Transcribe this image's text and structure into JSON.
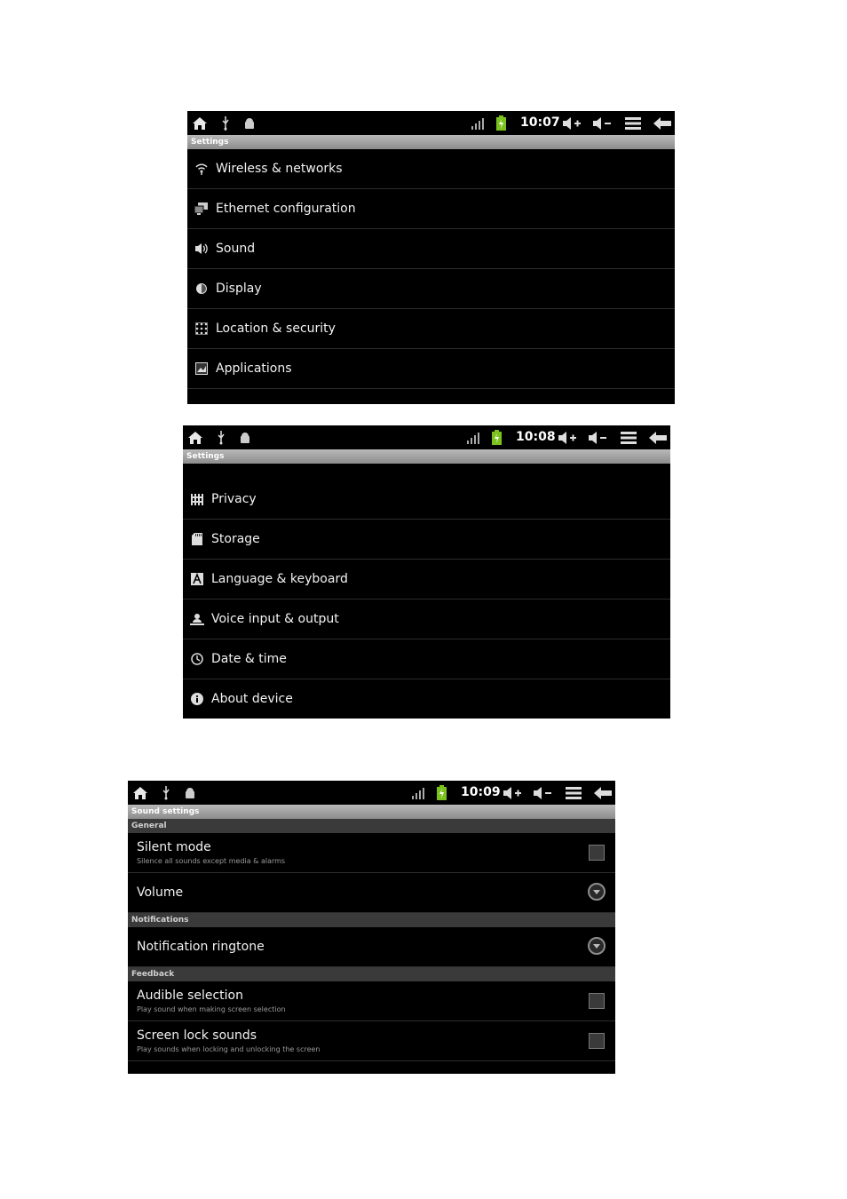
{
  "screen1": {
    "clock": "10:07",
    "title": "Settings",
    "items": [
      {
        "label": "Wireless & networks",
        "icon": "wifi-icon"
      },
      {
        "label": "Ethernet configuration",
        "icon": "ethernet-icon"
      },
      {
        "label": "Sound",
        "icon": "speaker-icon"
      },
      {
        "label": "Display",
        "icon": "brightness-icon"
      },
      {
        "label": "Location & security",
        "icon": "location-grid-icon"
      },
      {
        "label": "Applications",
        "icon": "applications-icon"
      }
    ]
  },
  "screen2": {
    "clock": "10:08",
    "title": "Settings",
    "items": [
      {
        "label": "Privacy",
        "icon": "privacy-icon"
      },
      {
        "label": "Storage",
        "icon": "sd-card-icon"
      },
      {
        "label": "Language & keyboard",
        "icon": "language-icon"
      },
      {
        "label": "Voice input & output",
        "icon": "voice-icon"
      },
      {
        "label": "Date & time",
        "icon": "clock-icon"
      },
      {
        "label": "About device",
        "icon": "info-icon"
      }
    ]
  },
  "screen3": {
    "clock": "10:09",
    "title": "Sound settings",
    "sections": {
      "general": "General",
      "notifications": "Notifications",
      "feedback": "Feedback"
    },
    "silent_mode": {
      "title": "Silent mode",
      "subtitle": "Silence all sounds except media & alarms",
      "checked": false
    },
    "volume": {
      "title": "Volume"
    },
    "notification_ringtone": {
      "title": "Notification ringtone"
    },
    "audible_selection": {
      "title": "Audible selection",
      "subtitle": "Play sound when making screen selection",
      "checked": false
    },
    "screen_lock_sounds": {
      "title": "Screen lock sounds",
      "subtitle": "Play sounds when locking and unlocking the screen",
      "checked": false
    }
  },
  "colors": {
    "background": "#000000",
    "titlebar": "#a0a0a0",
    "battery": "#7cc21f",
    "text": "#f2f2f2"
  }
}
